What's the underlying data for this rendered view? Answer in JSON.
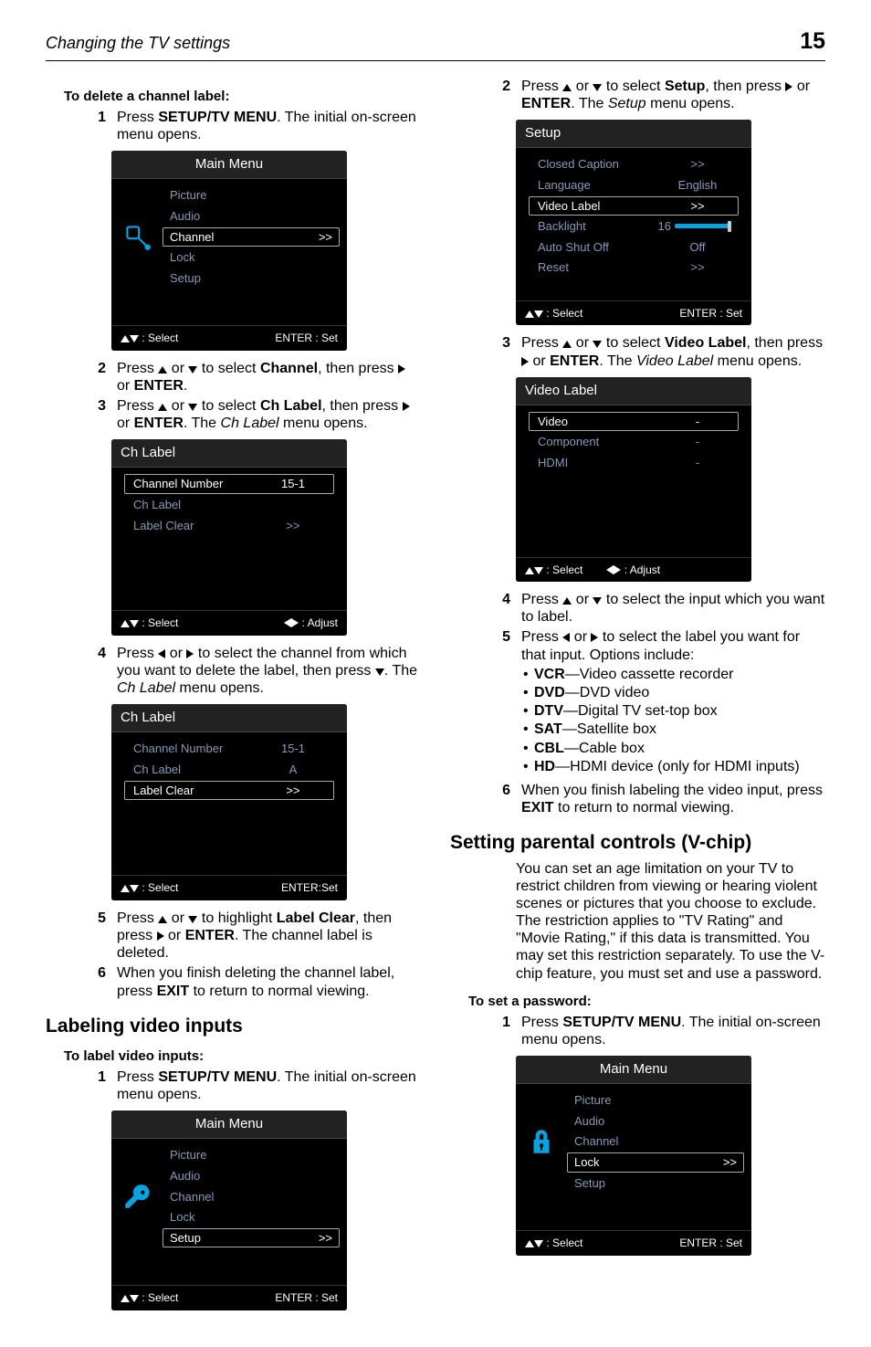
{
  "page": {
    "section_title": "Changing the TV settings",
    "page_number": "15"
  },
  "headings": {
    "delete_channel_label": "To delete a channel label:",
    "labeling_video_inputs": "Labeling video inputs",
    "to_label_video_inputs": "To label video inputs:",
    "setting_parental": "Setting parental controls (V-chip)",
    "to_set_password": "To set a password:"
  },
  "common": {
    "main_menu": "Main Menu",
    "select_footer": ": Select",
    "enter_set": "ENTER : Set",
    "enter_set_b": "ENTER:Set",
    "adjust": ": Adjust",
    "chevrons": ">>",
    "arrow_right": "▶",
    "arrow_left": "◀"
  },
  "menus": {
    "main_items": {
      "picture": "Picture",
      "audio": "Audio",
      "channel": "Channel",
      "lock": "Lock",
      "setup": "Setup"
    },
    "ch_label": {
      "title": "Ch Label",
      "channel_number": "Channel Number",
      "ch_label_row": "Ch Label",
      "label_clear": "Label Clear",
      "val_151": "15-1",
      "val_A": "A",
      "val_dash": "-"
    },
    "setup": {
      "title": "Setup",
      "closed_caption": "Closed Caption",
      "language": "Language",
      "language_val": "English",
      "video_label": "Video Label",
      "backlight": "Backlight",
      "backlight_val": "16",
      "auto_shut": "Auto Shut Off",
      "auto_shut_val": "Off",
      "reset": "Reset"
    },
    "video_label": {
      "title": "Video Label",
      "video": "Video",
      "component": "Component",
      "hdmi": "HDMI"
    }
  },
  "steps": {
    "L1": "Press <b>SETUP/TV MENU</b>. The initial on-screen menu opens.",
    "L2": "Press <span class='tri up tri-black'></span> or <span class='tri dn tri-black'></span> to select <b>Channel</b>, then press <span class='tri rt tri-black'></span> or <b>ENTER</b>.",
    "L3": "Press <span class='tri up tri-black'></span> or <span class='tri dn tri-black'></span> to select <b>Ch Label</b>, then press <span class='tri rt tri-black'></span> or <b>ENTER</b>. The <i>Ch Label</i> menu opens.",
    "L4": "Press <span class='tri lt tri-black'></span> or <span class='tri rt tri-black'></span> to select the channel from which you want to delete the label, then press <span class='tri dn tri-black'></span>. The <i>Ch Label</i> menu opens.",
    "L5": "Press <span class='tri up tri-black'></span> or <span class='tri dn tri-black'></span> to highlight <b>Label Clear</b>, then press <span class='tri rt tri-black'></span> or <b>ENTER</b>. The channel label is deleted.",
    "L6": "When you finish deleting the channel label, press <b>EXIT</b> to return to normal viewing.",
    "M1": "Press <b>SETUP/TV MENU</b>. The initial on-screen menu opens.",
    "R2": "Press <span class='tri up tri-black'></span> or <span class='tri dn tri-black'></span> to select <b>Setup</b>, then press <span class='tri rt tri-black'></span> or <b>ENTER</b>. The <i>Setup</i> menu opens.",
    "R3": "Press <span class='tri up tri-black'></span> or <span class='tri dn tri-black'></span> to select <b>Video Label</b>, then press <span class='tri rt tri-black'></span> or <b>ENTER</b>. The <i>Video Label</i> menu opens.",
    "R4": "Press <span class='tri up tri-black'></span> or <span class='tri dn tri-black'></span> to select the input which you want to label.",
    "R5": "Press <span class='tri lt tri-black'></span> or <span class='tri rt tri-black'></span> to select the label you want for that input. Options include:",
    "R6": "When you finish labeling the video input, press <b>EXIT</b> to return to normal viewing.",
    "P1": "Press <b>SETUP/TV MENU</b>. The initial on-screen menu opens."
  },
  "options": {
    "vcr": "<b>VCR</b>—Video cassette recorder",
    "dvd": "<b>DVD</b>—DVD video",
    "dtv": "<b>DTV</b>—Digital TV set-top box",
    "sat": "<b>SAT</b>—Satellite box",
    "cbl": "<b>CBL</b>—Cable box",
    "hd": "<b>HD</b>—HDMI device (only for HDMI inputs)"
  },
  "parental_intro": "You can set an age limitation on your TV to restrict children from viewing or hearing violent scenes or pictures that you choose to exclude. The restriction applies to \"TV Rating\" and \"Movie Rating,\" if this data is transmitted. You may set this restriction separately. To use the V-chip feature, you must set and use a password."
}
